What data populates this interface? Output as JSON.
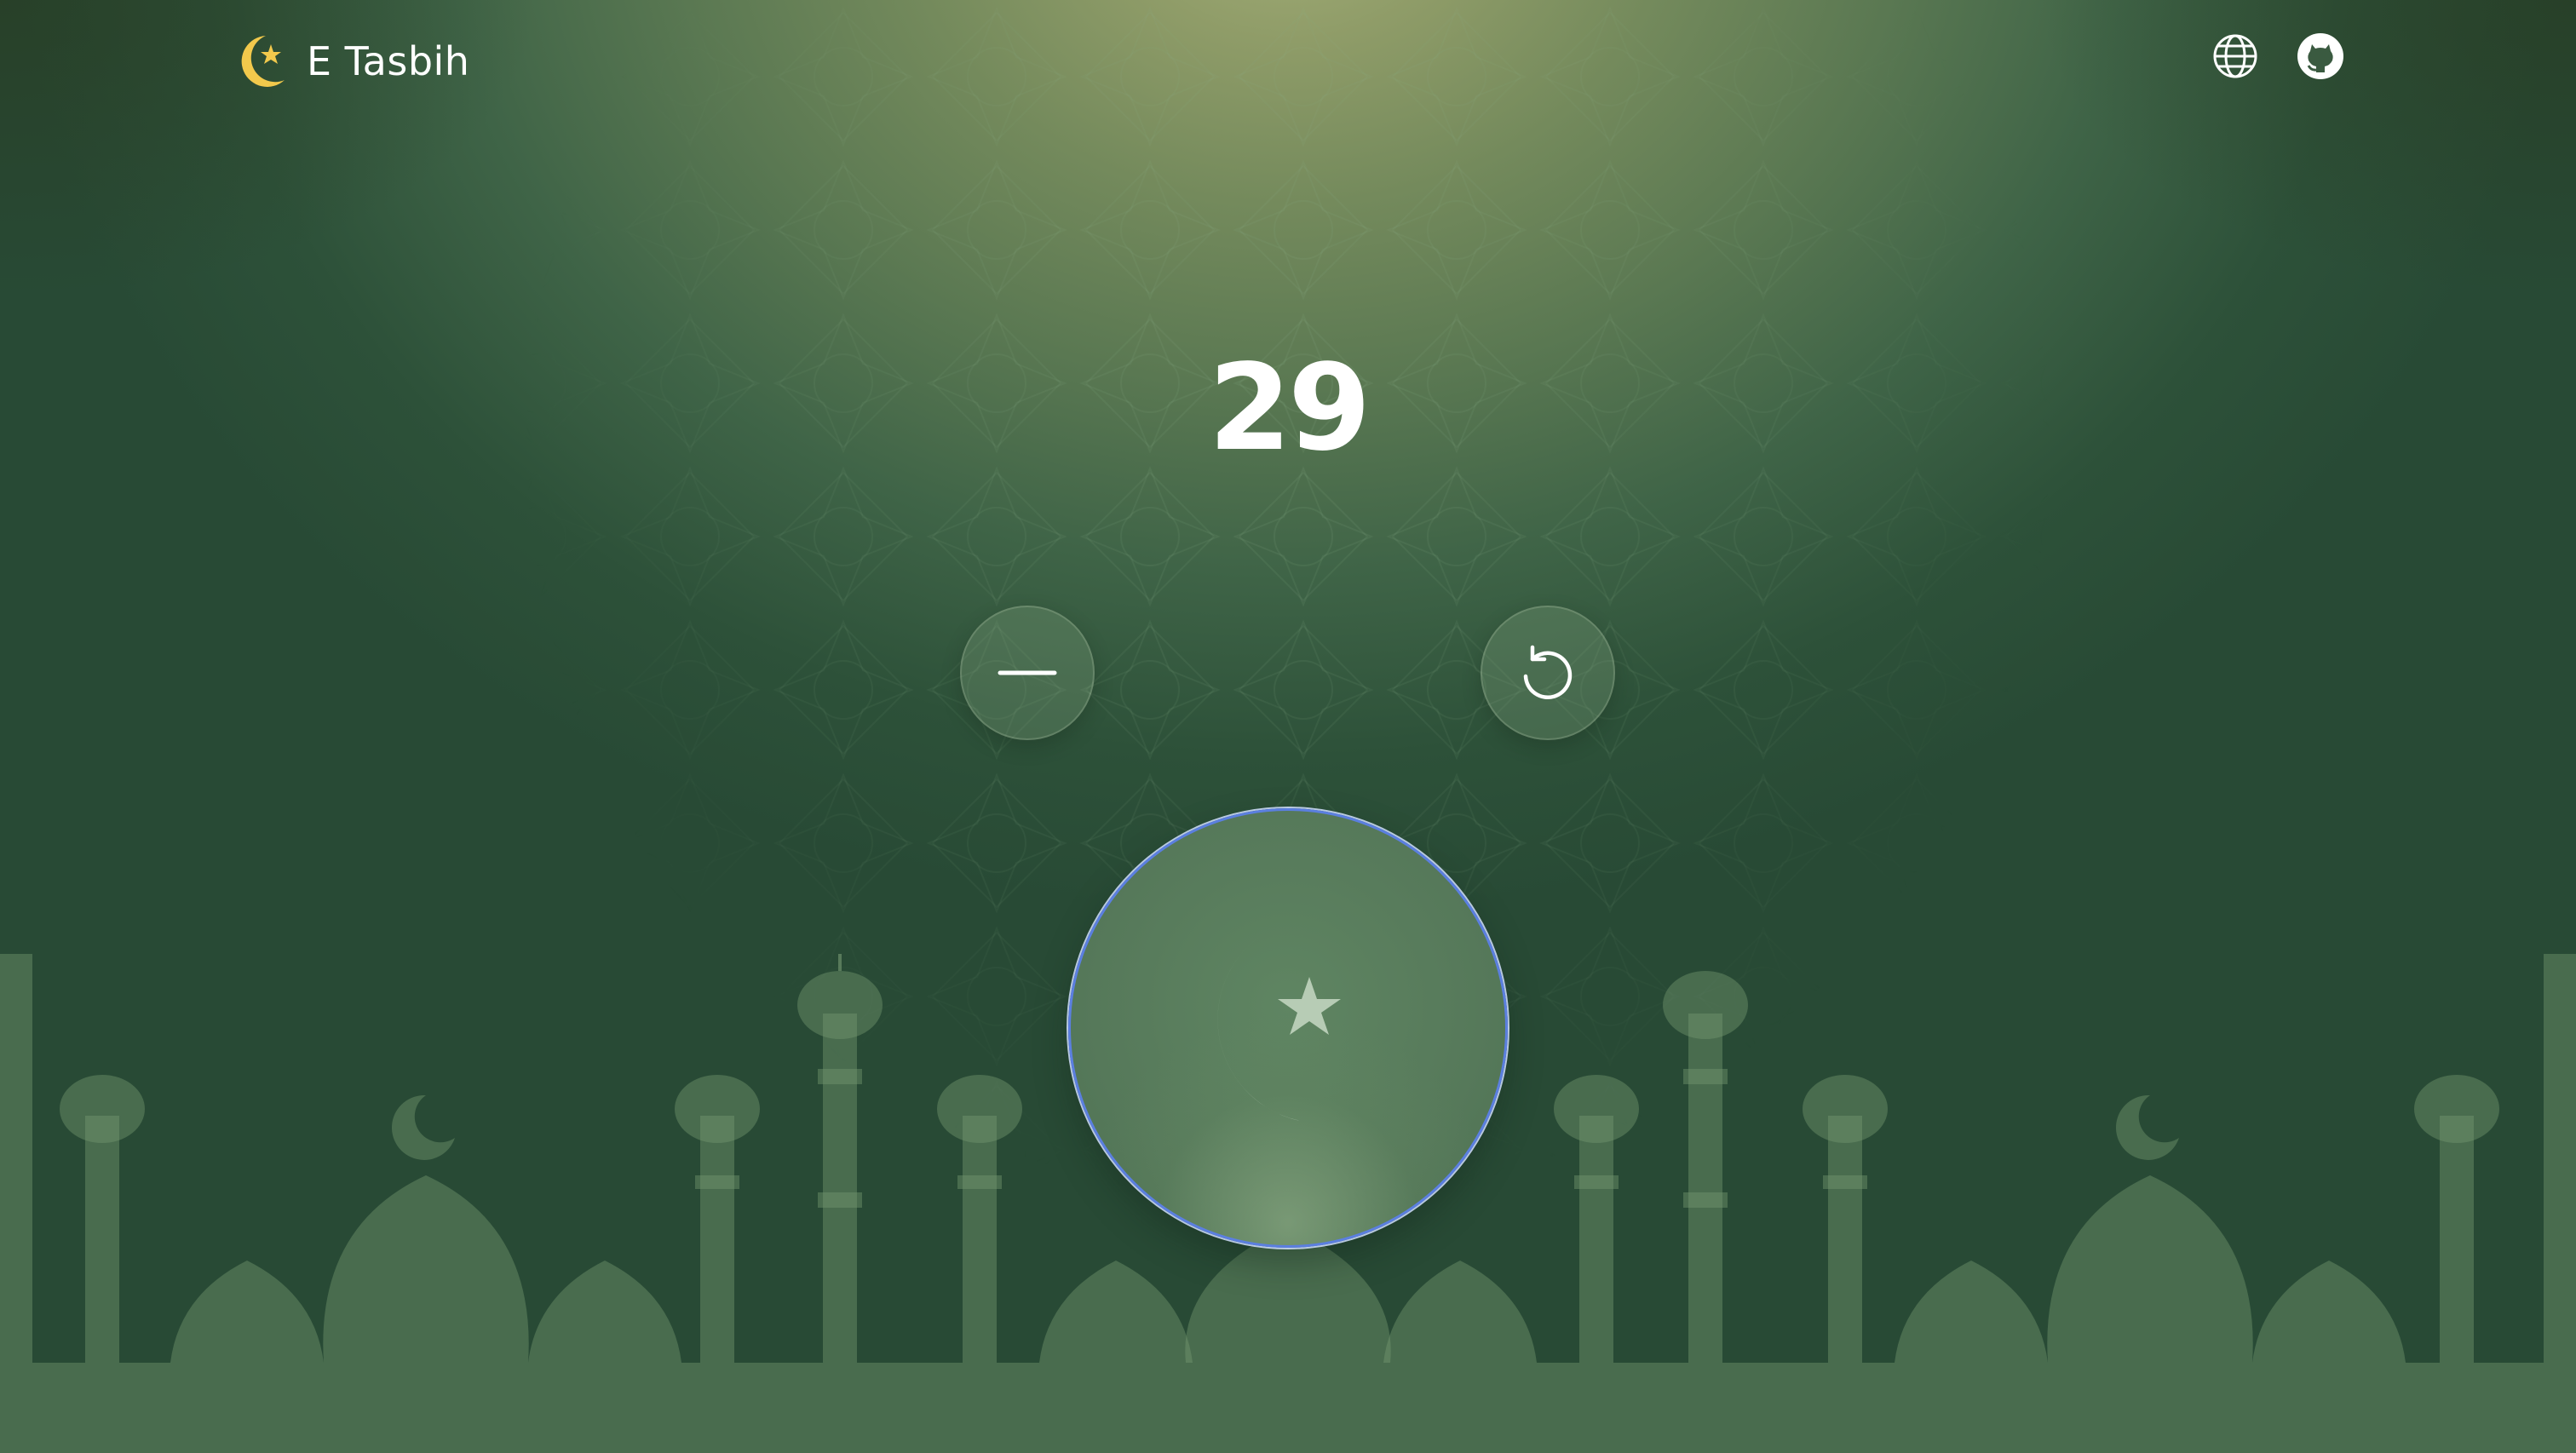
{
  "app": {
    "title": "E Tasbih",
    "logo_icon": "crescent-star-icon"
  },
  "header": {
    "language_icon": "globe-icon",
    "github_icon": "github-icon"
  },
  "counter": {
    "value": "29"
  },
  "controls": {
    "decrement_icon": "minus-icon",
    "reset_icon": "reset-icon",
    "tap_icon": "crescent-star-icon"
  },
  "colors": {
    "accent_gold": "#f2c94c",
    "focus_ring": "#5b7fe0",
    "text": "#ffffff"
  }
}
